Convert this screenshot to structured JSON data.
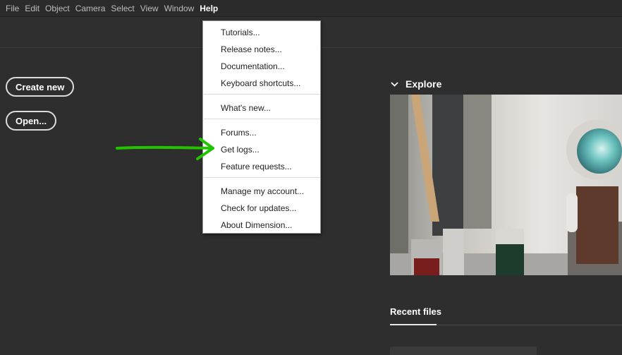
{
  "menubar": {
    "items": [
      {
        "label": "File"
      },
      {
        "label": "Edit"
      },
      {
        "label": "Object"
      },
      {
        "label": "Camera"
      },
      {
        "label": "Select"
      },
      {
        "label": "View"
      },
      {
        "label": "Window"
      },
      {
        "label": "Help"
      }
    ]
  },
  "home": {
    "create_label": "Create new",
    "open_label": "Open...",
    "explore_title": "Explore",
    "recent_title": "Recent files"
  },
  "help_menu": {
    "items": [
      {
        "label": "Tutorials..."
      },
      {
        "label": "Release notes..."
      },
      {
        "label": "Documentation..."
      },
      {
        "label": "Keyboard shortcuts..."
      },
      {
        "label": "What's new..."
      },
      {
        "label": "Forums..."
      },
      {
        "label": "Get logs..."
      },
      {
        "label": "Feature requests..."
      },
      {
        "label": "Manage my account..."
      },
      {
        "label": "Check for updates..."
      },
      {
        "label": "About Dimension..."
      }
    ]
  },
  "annotation": {
    "color": "#22c400"
  }
}
